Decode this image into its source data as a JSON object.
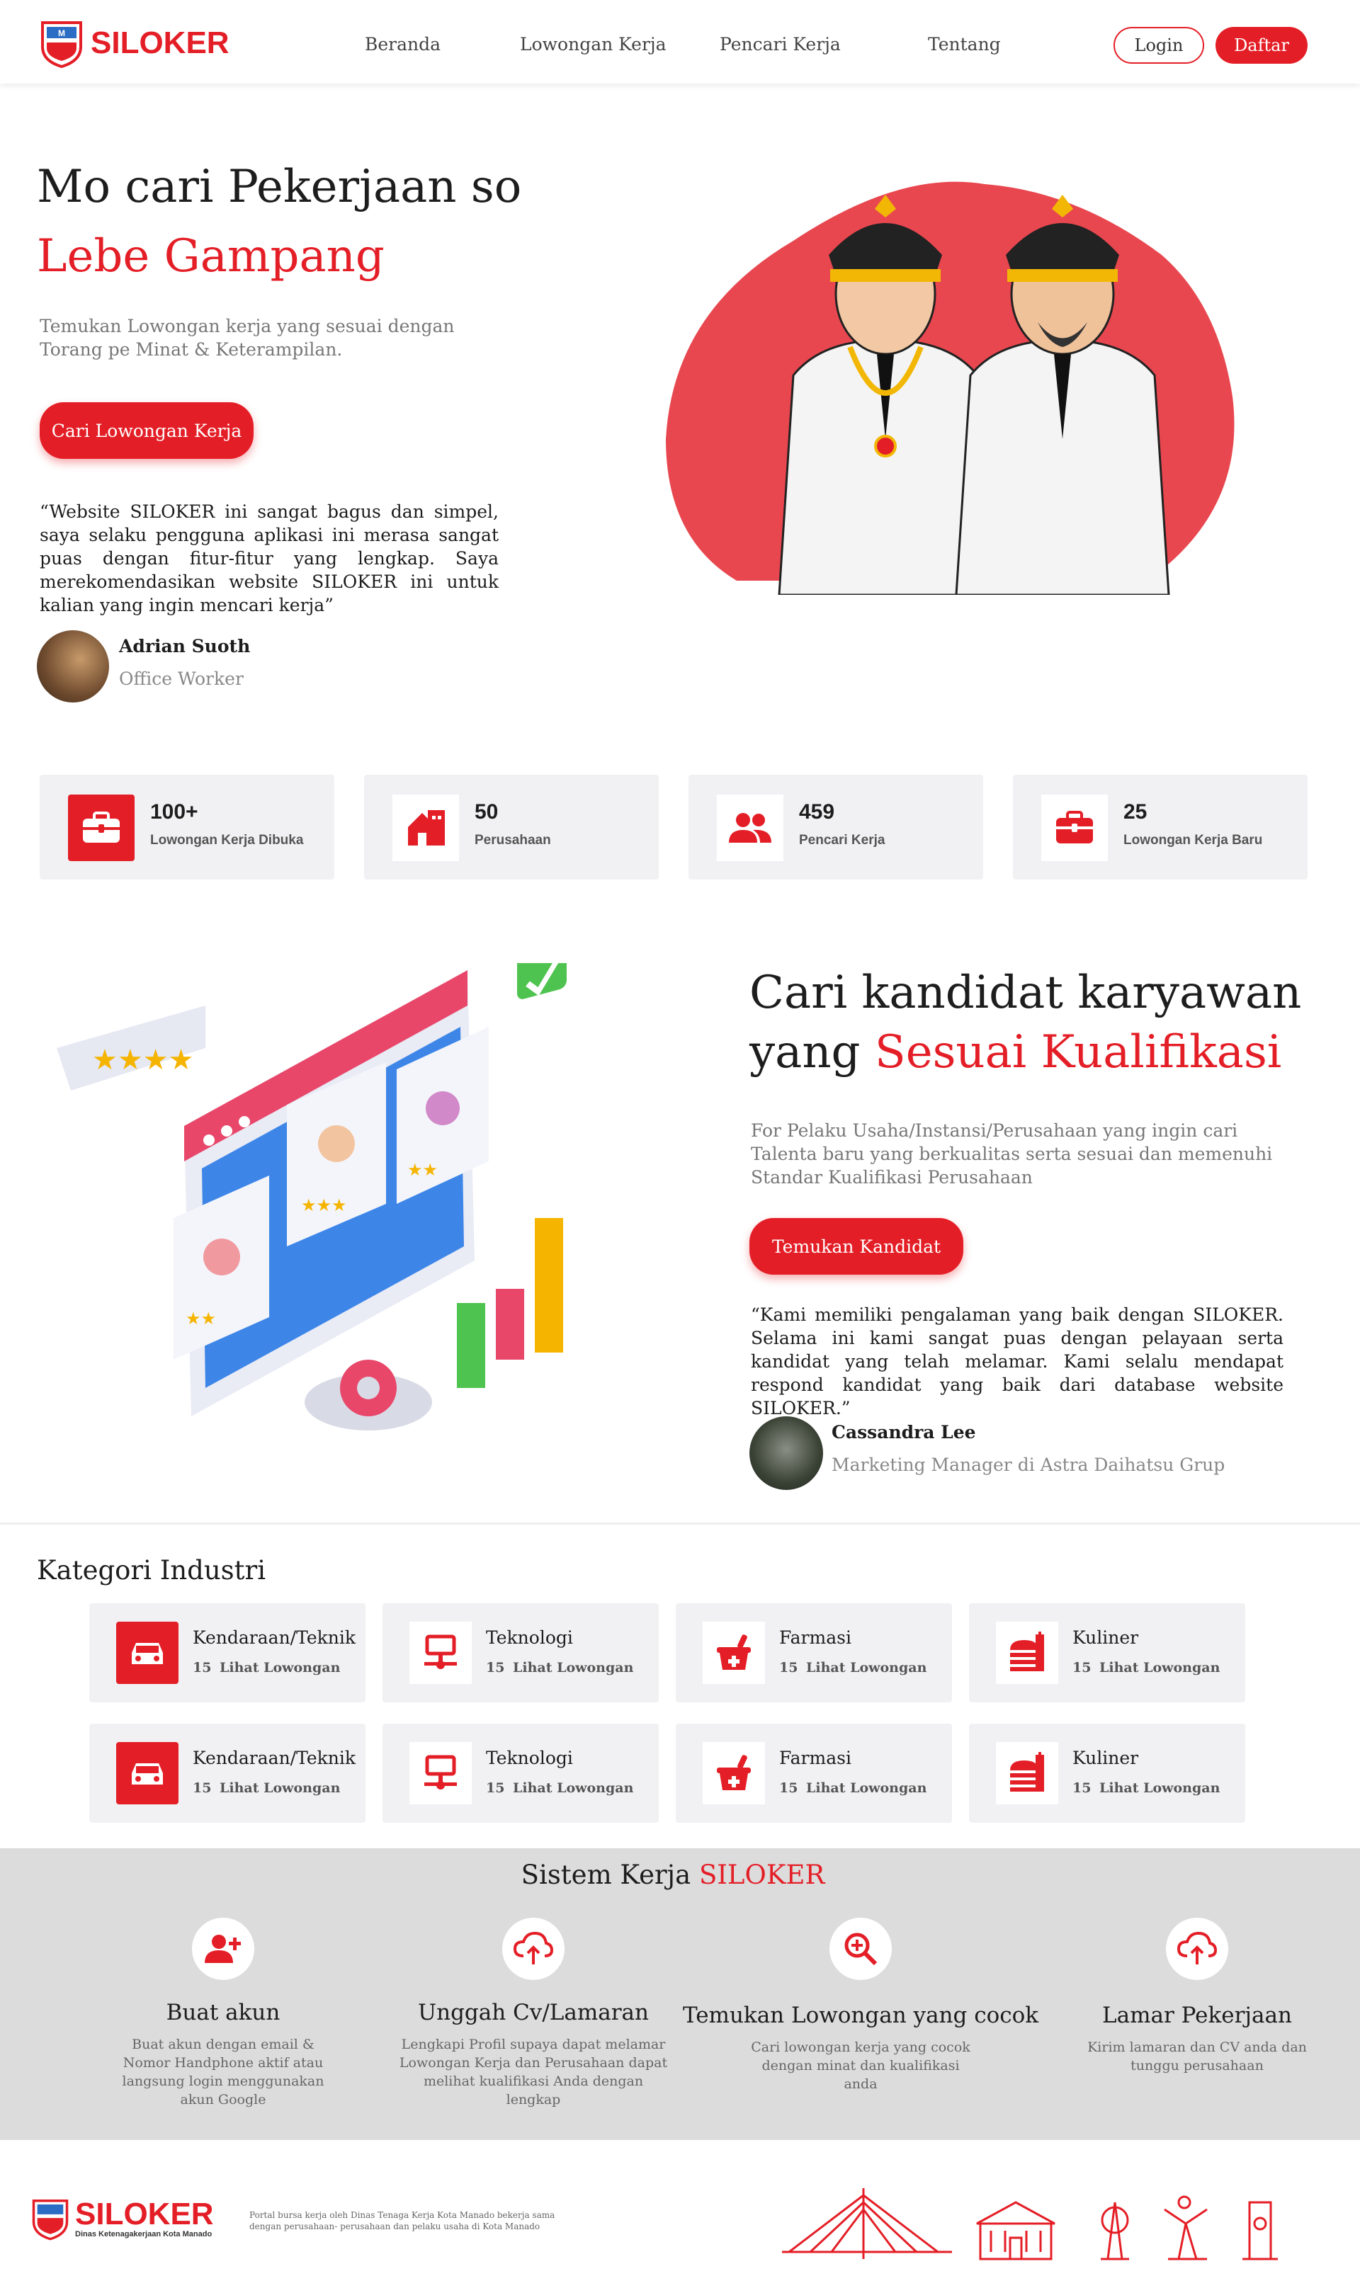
{
  "brand": {
    "name": "SILOKER",
    "footer_name": "SILOKER",
    "footer_sub": "Dinas Ketenagakerjaan Kota Manado"
  },
  "nav": {
    "items": [
      "Beranda",
      "Lowongan Kerja",
      "Pencari Kerja",
      "Tentang"
    ],
    "login": "Login",
    "register": "Daftar"
  },
  "hero": {
    "title_line1": "Mo cari Pekerjaan so",
    "title_line2": "Lebe Gampang",
    "subtitle": "Temukan Lowongan kerja yang sesuai dengan Torang pe Minat & Keterampilan.",
    "cta": "Cari Lowongan Kerja",
    "quote": "“Website SILOKER ini sangat bagus dan simpel, saya selaku pengguna aplikasi ini merasa sangat puas dengan fitur-fitur yang lengkap. Saya merekomendasikan website SILOKER ini untuk kalian yang ingin mencari kerja”",
    "author_name": "Adrian Suoth",
    "author_role": "Office Worker"
  },
  "stats": [
    {
      "value": "100+",
      "label": "Lowongan Kerja Dibuka",
      "icon": "briefcase-icon"
    },
    {
      "value": "50",
      "label": "Perusahaan",
      "icon": "building-icon"
    },
    {
      "value": "459",
      "label": "Pencari Kerja",
      "icon": "users-icon"
    },
    {
      "value": "25",
      "label": "Lowongan Kerja Baru",
      "icon": "briefcase-new-icon"
    }
  ],
  "recruit": {
    "title_line1": "Cari kandidat karyawan",
    "title_line2_plain": "yang ",
    "title_line2_red": "Sesuai Kualifikasi",
    "subtitle": "For Pelaku Usaha/Instansi/Perusahaan yang ingin cari Talenta baru yang berkualitas serta sesuai dan memenuhi Standar Kualifikasi Perusahaan",
    "cta": "Temukan Kandidat",
    "quote": "“Kami memiliki pengalaman yang baik dengan SILOKER. Selama ini kami sangat puas dengan pelayaan serta kandidat yang telah melamar. Kami selalu mendapat respond kandidat yang baik dari database website SILOKER.”",
    "author_name": "Cassandra Lee",
    "author_role": "Marketing Manager di Astra Daihatsu Grup"
  },
  "categories": {
    "title": "Kategori Industri",
    "link_label": "Lihat Lowongan",
    "items": [
      {
        "name": "Kendaraan/Teknik",
        "count": "15",
        "icon": "car-icon",
        "active": true
      },
      {
        "name": "Teknologi",
        "count": "15",
        "icon": "network-icon",
        "active": false
      },
      {
        "name": "Farmasi",
        "count": "15",
        "icon": "pharmacy-icon",
        "active": false
      },
      {
        "name": "Kuliner",
        "count": "15",
        "icon": "food-icon",
        "active": false
      },
      {
        "name": "Kendaraan/Teknik",
        "count": "15",
        "icon": "car-icon",
        "active": true
      },
      {
        "name": "Teknologi",
        "count": "15",
        "icon": "network-icon",
        "active": false
      },
      {
        "name": "Farmasi",
        "count": "15",
        "icon": "pharmacy-icon",
        "active": false
      },
      {
        "name": "Kuliner",
        "count": "15",
        "icon": "food-icon",
        "active": false
      }
    ]
  },
  "system": {
    "title_plain": "Sistem Kerja ",
    "title_red": "SILOKER",
    "steps": [
      {
        "title": "Buat akun",
        "desc": "Buat akun dengan email & Nomor Handphone aktif atau langsung login menggunakan akun Google",
        "icon": "add-user-icon"
      },
      {
        "title": "Unggah Cv/Lamaran",
        "desc": "Lengkapi Profil supaya dapat melamar Lowongan Kerja dan Perusahaan dapat melihat kualifikasi Anda dengan lengkap",
        "icon": "cloud-upload-icon"
      },
      {
        "title": "Temukan Lowongan yang cocok",
        "desc": "Cari lowongan kerja yang cocok dengan minat dan kualifikasi anda",
        "icon": "search-zoom-icon"
      },
      {
        "title": "Lamar Pekerjaan",
        "desc": "Kirim lamaran dan CV anda dan tunggu perusahaan",
        "icon": "cloud-upload-icon"
      }
    ]
  },
  "footer": {
    "desc": "Portal bursa kerja oleh Dinas Tenaga Kerja Kota Manado bekerja sama dengan perusahaan- perusahaan dan pelaku usaha di Kota Manado"
  },
  "colors": {
    "accent": "#e41e26",
    "card_bg": "#f1f1f3",
    "system_bg": "#dcdcdc",
    "hero_blob": "#e8474f"
  }
}
